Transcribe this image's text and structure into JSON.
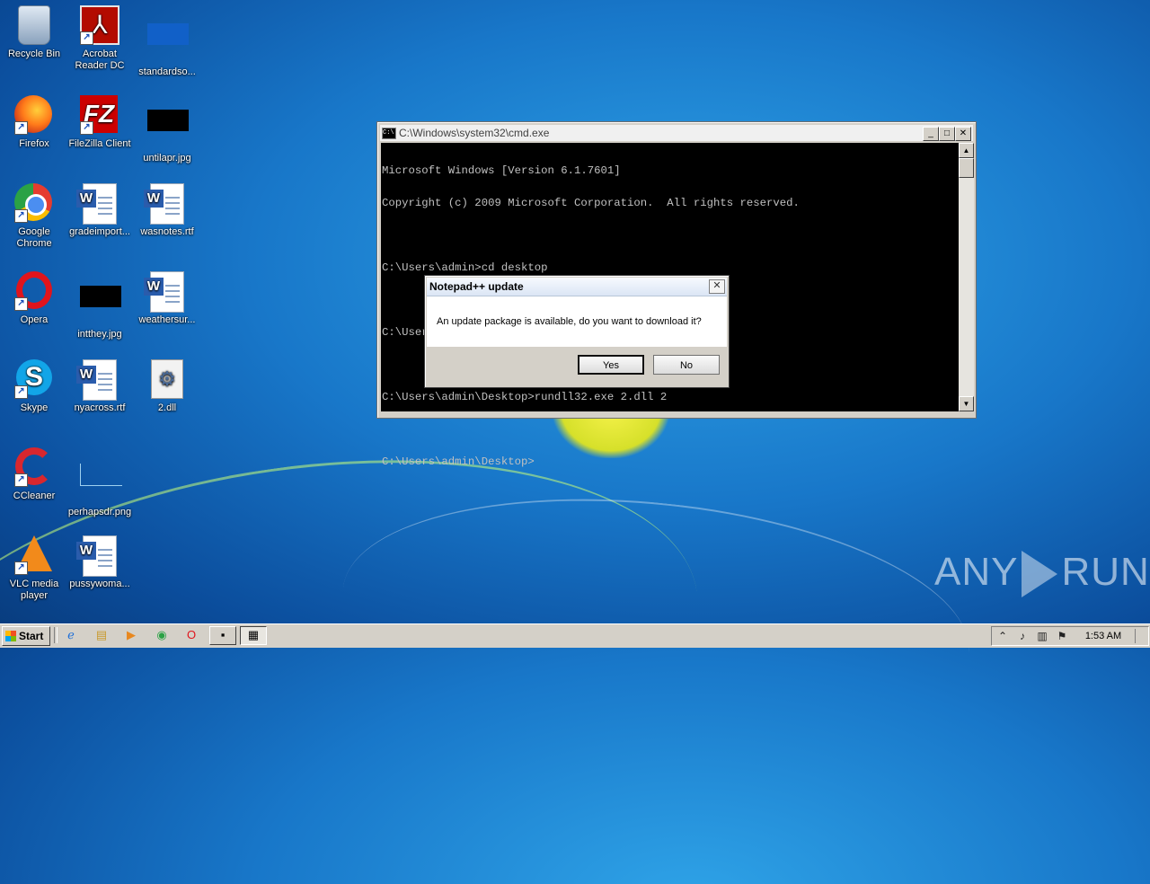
{
  "desktop": {
    "icons": [
      {
        "label": "Recycle Bin",
        "icon": "recycle-bin-icon"
      },
      {
        "label": "Acrobat Reader DC",
        "icon": "acrobat-icon"
      },
      {
        "label": "standardso...",
        "icon": "image-file-icon"
      },
      {
        "label": "Firefox",
        "icon": "firefox-icon"
      },
      {
        "label": "FileZilla Client",
        "icon": "filezilla-icon"
      },
      {
        "label": "untilapr.jpg",
        "icon": "image-file-icon"
      },
      {
        "label": "Google Chrome",
        "icon": "chrome-icon"
      },
      {
        "label": "gradeimport...",
        "icon": "word-doc-icon"
      },
      {
        "label": "wasnotes.rtf",
        "icon": "word-doc-icon"
      },
      {
        "label": "Opera",
        "icon": "opera-icon"
      },
      {
        "label": "intthey.jpg",
        "icon": "image-file-icon"
      },
      {
        "label": "weathersur...",
        "icon": "word-doc-icon"
      },
      {
        "label": "Skype",
        "icon": "skype-icon"
      },
      {
        "label": "nyacross.rtf",
        "icon": "word-doc-icon"
      },
      {
        "label": "2.dll",
        "icon": "dll-file-icon"
      },
      {
        "label": "CCleaner",
        "icon": "ccleaner-icon"
      },
      {
        "label": "perhapsdr.png",
        "icon": "image-file-icon"
      },
      {
        "label": "VLC media player",
        "icon": "vlc-icon"
      },
      {
        "label": "pussywoma...",
        "icon": "word-doc-icon"
      }
    ]
  },
  "cmd": {
    "title": "C:\\Windows\\system32\\cmd.exe",
    "icon_text": "C:\\",
    "lines": [
      "Microsoft Windows [Version 6.1.7601]",
      "Copyright (c) 2009 Microsoft Corporation.  All rights reserved.",
      "",
      "C:\\Users\\admin>cd desktop",
      "",
      "C:\\Users\\admin\\Desktop>rundll32.exe 2.dll",
      "",
      "C:\\Users\\admin\\Desktop>rundll32.exe 2.dll 2",
      "",
      "C:\\Users\\admin\\Desktop>"
    ],
    "buttons": {
      "minimize": "_",
      "maximize": "□",
      "close": "✕"
    }
  },
  "dialog": {
    "title": "Notepad++ update",
    "message": "An update package is available, do you want to download it?",
    "yes_label": "Yes",
    "no_label": "No",
    "close_glyph": "✕"
  },
  "taskbar": {
    "start_label": "Start",
    "clock": "1:53 AM",
    "quick_launch": [
      "ie-icon",
      "explorer-icon",
      "media-player-icon",
      "chrome-icon",
      "opera-icon"
    ],
    "tasks": [
      "cmd-task-icon",
      "notepadpp-task-icon"
    ],
    "tray": [
      "show-hidden-icons-icon",
      "volume-icon",
      "network-icon",
      "action-center-flag-icon"
    ]
  },
  "watermark": {
    "left": "ANY",
    "right": "RUN"
  }
}
